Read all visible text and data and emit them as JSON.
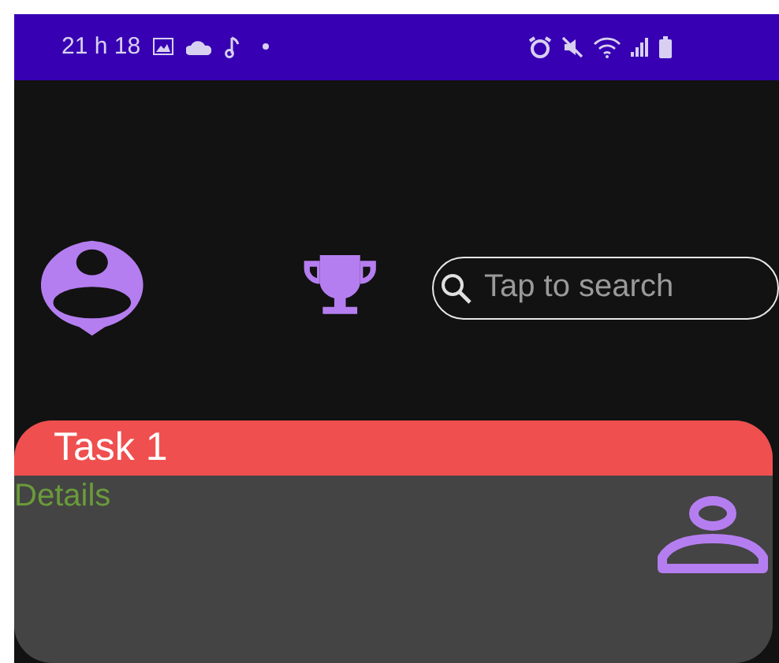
{
  "status_bar": {
    "time": "21 h 18"
  },
  "search": {
    "placeholder": "Tap to search"
  },
  "tasks": [
    {
      "title": "Task 1",
      "details": "Details",
      "color": "#ef4f4f"
    }
  ]
}
